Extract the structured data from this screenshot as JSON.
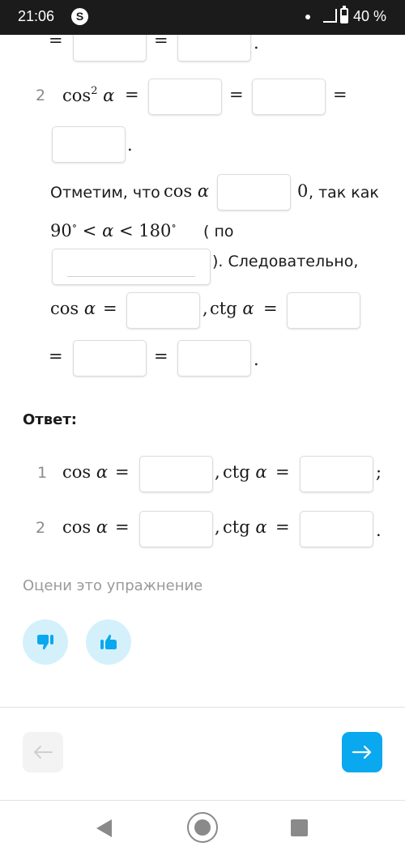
{
  "status_bar": {
    "time": "21:06",
    "app_icon": "shazam-icon",
    "battery_percent": "40 %"
  },
  "solution": {
    "top_fragment": {
      "eq1": "=",
      "eq2": "=",
      "period": "."
    },
    "item2": {
      "number": "2",
      "lhs_func": "cos",
      "lhs_exp": "2",
      "lhs_var": "α",
      "eq": "=",
      "period": "."
    },
    "note": {
      "text1": "Отметим, что",
      "func": "cos",
      "var": "α",
      "zero": "0",
      "text2": ", так как",
      "range_low": "90",
      "range_high": "180",
      "deg": "∘",
      "lt": "<",
      "var2": "α",
      "text3": "( по",
      "text4": "). Следовательно,"
    },
    "result": {
      "cos_label": "cos",
      "ctg_label": "ctg",
      "var": "α",
      "eq": "=",
      "comma": ",",
      "period": "."
    }
  },
  "answer": {
    "title": "Ответ:",
    "rows": [
      {
        "number": "1",
        "cos": "cos",
        "ctg": "ctg",
        "var": "α",
        "eq": "=",
        "comma": ",",
        "end": ";"
      },
      {
        "number": "2",
        "cos": "cos",
        "ctg": "ctg",
        "var": "α",
        "eq": "=",
        "comma": ",",
        "end": "."
      }
    ]
  },
  "rating": {
    "label": "Оцени это упражнение",
    "dislike_icon": "thumbs-down-icon",
    "like_icon": "thumbs-up-icon",
    "accent_color": "#0aa8ee",
    "bg_color": "#d4f1fb"
  },
  "navigation": {
    "prev_icon": "arrow-left-icon",
    "next_icon": "arrow-right-icon",
    "next_color": "#0aa8ee"
  }
}
